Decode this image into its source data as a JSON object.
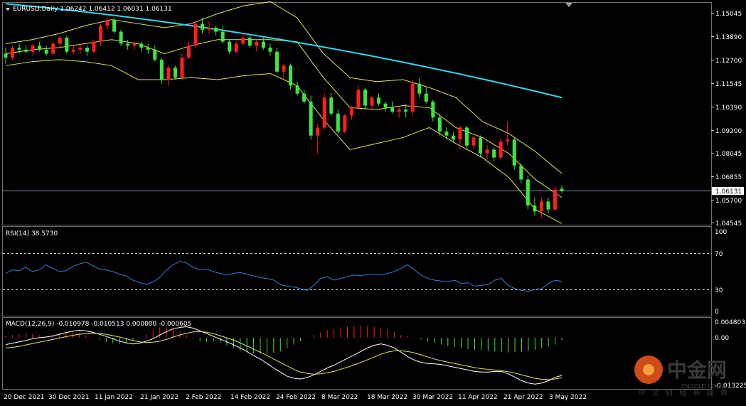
{
  "main_panel": {
    "header": "EURUSD,Daily  1.06242 1.06412 1.06031 1.06131",
    "current_price_label": "1.06131",
    "price_ticks": [
      "1.15045",
      "1.13890",
      "1.12700",
      "1.11545",
      "1.10390",
      "1.09200",
      "1.08045",
      "1.06855",
      "1.05700",
      "1.04545"
    ]
  },
  "rsi_panel": {
    "header": "RSI(14) 38.5730",
    "ticks": [
      "100",
      "70",
      "30",
      "0"
    ]
  },
  "macd_panel": {
    "header": "MACD(12,26,9) -0.010978 -0.010513 0.000000 -0.000605",
    "ticks": [
      "0.004803",
      "0.00",
      "-0.013225"
    ]
  },
  "x_ticks": [
    "20 Dec 2021",
    "30 Dec 2021",
    "11 Jan 2022",
    "21 Jan 2022",
    "2 Feb 2022",
    "14 Feb 2022",
    "24 Feb 2022",
    "8 Mar 2022",
    "18 Mar 2022",
    "30 Mar 2022",
    "11 Apr 2022",
    "21 Apr 2022",
    "3 May 2022"
  ],
  "watermark": {
    "brand": "中金网",
    "site": "CNGOLD.COM",
    "tagline": "中 文 财 经 新 媒 体"
  },
  "colors": {
    "bull": "#ff1e1e",
    "bear": "#3ee63e",
    "ma": "#33d6f0",
    "bands": "#e6e651",
    "rsi": "#3a7bd5",
    "macd_line": "#ffffff",
    "signal_line": "#e6e651",
    "grid_dash": "#cfcfcf"
  },
  "chart_data": {
    "type": "candlestick",
    "symbol": "EURUSD",
    "timeframe": "Daily",
    "ylim": [
      1.0455,
      1.156
    ],
    "candles": [
      [
        1.13,
        1.133,
        1.125,
        1.128
      ],
      [
        1.128,
        1.134,
        1.127,
        1.133
      ],
      [
        1.133,
        1.135,
        1.13,
        1.132
      ],
      [
        1.132,
        1.134,
        1.13,
        1.131
      ],
      [
        1.131,
        1.135,
        1.129,
        1.134
      ],
      [
        1.134,
        1.136,
        1.131,
        1.132
      ],
      [
        1.132,
        1.134,
        1.129,
        1.13
      ],
      [
        1.13,
        1.136,
        1.129,
        1.135
      ],
      [
        1.135,
        1.139,
        1.133,
        1.138
      ],
      [
        1.138,
        1.139,
        1.13,
        1.131
      ],
      [
        1.131,
        1.134,
        1.13,
        1.132
      ],
      [
        1.132,
        1.135,
        1.13,
        1.133
      ],
      [
        1.133,
        1.134,
        1.129,
        1.131
      ],
      [
        1.131,
        1.137,
        1.13,
        1.136
      ],
      [
        1.136,
        1.145,
        1.134,
        1.144
      ],
      [
        1.144,
        1.148,
        1.142,
        1.147
      ],
      [
        1.147,
        1.148,
        1.14,
        1.141
      ],
      [
        1.141,
        1.142,
        1.134,
        1.135
      ],
      [
        1.135,
        1.137,
        1.132,
        1.134
      ],
      [
        1.134,
        1.136,
        1.132,
        1.135
      ],
      [
        1.135,
        1.136,
        1.131,
        1.133
      ],
      [
        1.133,
        1.135,
        1.13,
        1.132
      ],
      [
        1.132,
        1.134,
        1.126,
        1.127
      ],
      [
        1.127,
        1.128,
        1.115,
        1.117
      ],
      [
        1.117,
        1.124,
        1.114,
        1.123
      ],
      [
        1.123,
        1.124,
        1.117,
        1.118
      ],
      [
        1.118,
        1.13,
        1.117,
        1.128
      ],
      [
        1.128,
        1.136,
        1.127,
        1.134
      ],
      [
        1.134,
        1.146,
        1.133,
        1.145
      ],
      [
        1.145,
        1.148,
        1.14,
        1.142
      ],
      [
        1.142,
        1.146,
        1.14,
        1.143
      ],
      [
        1.143,
        1.144,
        1.139,
        1.141
      ],
      [
        1.141,
        1.144,
        1.135,
        1.136
      ],
      [
        1.136,
        1.137,
        1.13,
        1.131
      ],
      [
        1.131,
        1.136,
        1.13,
        1.135
      ],
      [
        1.135,
        1.14,
        1.134,
        1.138
      ],
      [
        1.138,
        1.139,
        1.133,
        1.134
      ],
      [
        1.134,
        1.137,
        1.131,
        1.136
      ],
      [
        1.136,
        1.138,
        1.132,
        1.133
      ],
      [
        1.133,
        1.135,
        1.129,
        1.131
      ],
      [
        1.131,
        1.133,
        1.12,
        1.121
      ],
      [
        1.121,
        1.125,
        1.117,
        1.124
      ],
      [
        1.124,
        1.125,
        1.112,
        1.114
      ],
      [
        1.114,
        1.116,
        1.109,
        1.11
      ],
      [
        1.11,
        1.112,
        1.105,
        1.106
      ],
      [
        1.106,
        1.109,
        1.087,
        1.089
      ],
      [
        1.089,
        1.095,
        1.08,
        1.093
      ],
      [
        1.093,
        1.11,
        1.092,
        1.108
      ],
      [
        1.108,
        1.11,
        1.099,
        1.1
      ],
      [
        1.1,
        1.102,
        1.09,
        1.091
      ],
      [
        1.091,
        1.1,
        1.09,
        1.099
      ],
      [
        1.099,
        1.104,
        1.097,
        1.103
      ],
      [
        1.103,
        1.114,
        1.102,
        1.112
      ],
      [
        1.112,
        1.113,
        1.102,
        1.104
      ],
      [
        1.104,
        1.109,
        1.102,
        1.108
      ],
      [
        1.108,
        1.11,
        1.104,
        1.105
      ],
      [
        1.105,
        1.106,
        1.101,
        1.103
      ],
      [
        1.103,
        1.106,
        1.1,
        1.101
      ],
      [
        1.101,
        1.104,
        1.098,
        1.102
      ],
      [
        1.102,
        1.105,
        1.098,
        1.101
      ],
      [
        1.101,
        1.117,
        1.099,
        1.115
      ],
      [
        1.115,
        1.118,
        1.108,
        1.11
      ],
      [
        1.11,
        1.113,
        1.105,
        1.106
      ],
      [
        1.106,
        1.107,
        1.096,
        1.098
      ],
      [
        1.098,
        1.1,
        1.089,
        1.091
      ],
      [
        1.091,
        1.093,
        1.087,
        1.089
      ],
      [
        1.089,
        1.091,
        1.086,
        1.087
      ],
      [
        1.087,
        1.094,
        1.082,
        1.093
      ],
      [
        1.093,
        1.094,
        1.082,
        1.084
      ],
      [
        1.084,
        1.089,
        1.082,
        1.088
      ],
      [
        1.088,
        1.089,
        1.078,
        1.08
      ],
      [
        1.08,
        1.084,
        1.077,
        1.082
      ],
      [
        1.082,
        1.083,
        1.076,
        1.078
      ],
      [
        1.078,
        1.088,
        1.077,
        1.086
      ],
      [
        1.086,
        1.096,
        1.084,
        1.087
      ],
      [
        1.087,
        1.088,
        1.072,
        1.074
      ],
      [
        1.074,
        1.075,
        1.065,
        1.067
      ],
      [
        1.067,
        1.069,
        1.052,
        1.054
      ],
      [
        1.054,
        1.058,
        1.049,
        1.051
      ],
      [
        1.051,
        1.058,
        1.048,
        1.056
      ],
      [
        1.056,
        1.058,
        1.05,
        1.052
      ],
      [
        1.052,
        1.064,
        1.051,
        1.062
      ],
      [
        1.0624,
        1.0641,
        1.0603,
        1.0613
      ]
    ],
    "ma": {
      "start": 1.155,
      "end": 1.108
    },
    "bands_upper": [
      1.135,
      1.137,
      1.14,
      1.144,
      1.147,
      1.145,
      1.143,
      1.145,
      1.15,
      1.154,
      1.156,
      1.148,
      1.13,
      1.118,
      1.116,
      1.117,
      1.113,
      1.108,
      1.096,
      1.09,
      1.081,
      1.07
    ],
    "bands_mid": [
      1.13,
      1.132,
      1.133,
      1.135,
      1.137,
      1.135,
      1.13,
      1.134,
      1.137,
      1.137,
      1.137,
      1.136,
      1.118,
      1.103,
      1.102,
      1.104,
      1.103,
      1.093,
      1.088,
      1.08,
      1.067,
      1.058
    ],
    "bands_lower": [
      1.124,
      1.126,
      1.127,
      1.126,
      1.124,
      1.117,
      1.117,
      1.118,
      1.117,
      1.119,
      1.12,
      1.114,
      1.097,
      1.082,
      1.085,
      1.088,
      1.093,
      1.085,
      1.078,
      1.068,
      1.052,
      1.045
    ],
    "rsi": [
      48,
      52,
      51,
      55,
      50,
      52,
      58,
      54,
      50,
      51,
      56,
      59,
      61,
      57,
      53,
      52,
      50,
      47,
      45,
      40,
      37,
      35,
      38,
      43,
      52,
      58,
      62,
      60,
      55,
      52,
      53,
      50,
      48,
      46,
      48,
      49,
      47,
      45,
      43,
      42,
      40,
      35,
      33,
      32,
      30,
      28,
      34,
      42,
      44,
      40,
      42,
      44,
      46,
      45,
      47,
      47,
      46,
      48,
      50,
      54,
      58,
      52,
      46,
      42,
      40,
      39,
      38,
      40,
      36,
      37,
      33,
      34,
      35,
      40,
      42,
      34,
      30,
      28,
      27,
      29,
      30,
      36,
      40,
      38.57
    ],
    "macd_hist": [
      0.0005,
      0.0008,
      0.001,
      0.0012,
      0.001,
      0.0008,
      0.0007,
      0.0009,
      0.0013,
      0.0016,
      0.0017,
      0.0014,
      0.0008,
      0.0,
      -0.0005,
      -0.0012,
      -0.0016,
      -0.0018,
      -0.0015,
      -0.001,
      -0.0002,
      0.001,
      0.0022,
      0.003,
      0.0032,
      0.0028,
      0.0018,
      0.0008,
      -0.0002,
      -0.001,
      -0.0012,
      -0.001,
      -0.0015,
      -0.0022,
      -0.003,
      -0.0038,
      -0.0042,
      -0.0045,
      -0.0047,
      -0.0048,
      -0.0044,
      -0.004,
      -0.003,
      -0.002,
      -0.001,
      0.0,
      0.0008,
      0.0016,
      0.0022,
      0.0026,
      0.003,
      0.0033,
      0.0035,
      0.0036,
      0.0035,
      0.0032,
      0.0028,
      0.0024,
      0.0016,
      0.0008,
      0.0004,
      0.0,
      -0.0005,
      -0.001,
      -0.0015,
      -0.002,
      -0.0024,
      -0.0027,
      -0.003,
      -0.0033,
      -0.0035,
      -0.0036,
      -0.0038,
      -0.004,
      -0.0042,
      -0.0043,
      -0.0042,
      -0.004,
      -0.0038,
      -0.0035,
      -0.003,
      -0.0025,
      -0.002,
      -0.0006
    ],
    "macd_line": [
      -0.002,
      -0.0016,
      -0.0012,
      -0.0008,
      -0.0003,
      0.0,
      0.0002,
      0.0005,
      0.001,
      0.0015,
      0.0019,
      0.0022,
      0.002,
      0.0016,
      0.001,
      0.0004,
      -0.0003,
      -0.001,
      -0.0015,
      -0.0018,
      -0.0016,
      -0.001,
      -0.0003,
      0.0008,
      0.0018,
      0.0026,
      0.003,
      0.0032,
      0.0028,
      0.002,
      0.0012,
      0.0004,
      -0.0004,
      -0.0012,
      -0.002,
      -0.003,
      -0.004,
      -0.0052,
      -0.0062,
      -0.0075,
      -0.0088,
      -0.01,
      -0.0112,
      -0.0118,
      -0.012,
      -0.0116,
      -0.0108,
      -0.0098,
      -0.0088,
      -0.008,
      -0.007,
      -0.006,
      -0.005,
      -0.004,
      -0.003,
      -0.0022,
      -0.0018,
      -0.0022,
      -0.003,
      -0.0042,
      -0.0055,
      -0.0065,
      -0.0072,
      -0.0075,
      -0.0076,
      -0.0078,
      -0.0082,
      -0.0086,
      -0.009,
      -0.0094,
      -0.0098,
      -0.01,
      -0.01,
      -0.0098,
      -0.0098,
      -0.0105,
      -0.0115,
      -0.0125,
      -0.0132,
      -0.0135,
      -0.0132,
      -0.0125,
      -0.0115,
      -0.011
    ],
    "signal_line": [
      -0.003,
      -0.0028,
      -0.0025,
      -0.0021,
      -0.0017,
      -0.0013,
      -0.0009,
      -0.0005,
      -0.0001,
      0.0003,
      0.0007,
      0.001,
      0.0012,
      0.0013,
      0.0012,
      0.001,
      0.0006,
      0.0002,
      -0.0003,
      -0.0008,
      -0.0012,
      -0.0014,
      -0.0013,
      -0.001,
      -0.0005,
      0.0002,
      0.0008,
      0.0013,
      0.0017,
      0.0018,
      0.0016,
      0.0012,
      0.0006,
      0.0,
      -0.0007,
      -0.0015,
      -0.0024,
      -0.0033,
      -0.0042,
      -0.0052,
      -0.0062,
      -0.0072,
      -0.0082,
      -0.0092,
      -0.01,
      -0.0104,
      -0.0106,
      -0.0105,
      -0.0102,
      -0.0098,
      -0.0092,
      -0.0086,
      -0.0079,
      -0.0072,
      -0.0064,
      -0.0056,
      -0.0048,
      -0.0042,
      -0.0038,
      -0.0038,
      -0.004,
      -0.0044,
      -0.005,
      -0.0056,
      -0.0062,
      -0.0067,
      -0.0071,
      -0.0075,
      -0.0079,
      -0.0083,
      -0.0087,
      -0.009,
      -0.0092,
      -0.0094,
      -0.0096,
      -0.0099,
      -0.0103,
      -0.0108,
      -0.0113,
      -0.0118,
      -0.0121,
      -0.0122,
      -0.012,
      -0.0116
    ]
  }
}
